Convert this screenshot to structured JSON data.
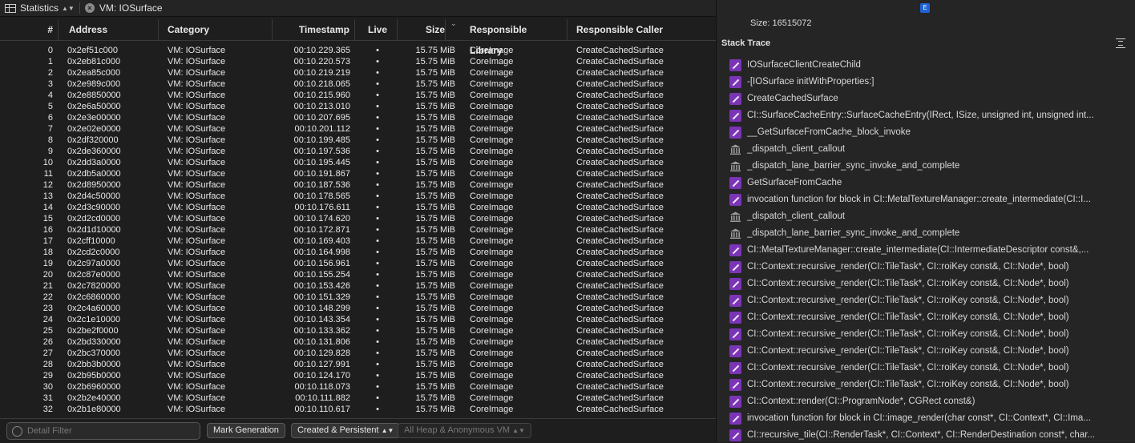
{
  "toolbar": {
    "view_label": "Statistics",
    "breadcrumb": "VM: IOSurface"
  },
  "columns": [
    "#",
    "Address",
    "Category",
    "Timestamp",
    "Live",
    "Size",
    "Responsible Library",
    "Responsible Caller"
  ],
  "rows": [
    [
      "0",
      "0x2ef51c000",
      "VM: IOSurface",
      "00:10.229.365",
      "•",
      "15.75 MiB",
      "CoreImage",
      "CreateCachedSurface"
    ],
    [
      "1",
      "0x2eb81c000",
      "VM: IOSurface",
      "00:10.220.573",
      "•",
      "15.75 MiB",
      "CoreImage",
      "CreateCachedSurface"
    ],
    [
      "2",
      "0x2ea85c000",
      "VM: IOSurface",
      "00:10.219.219",
      "•",
      "15.75 MiB",
      "CoreImage",
      "CreateCachedSurface"
    ],
    [
      "3",
      "0x2e989c000",
      "VM: IOSurface",
      "00:10.218.065",
      "•",
      "15.75 MiB",
      "CoreImage",
      "CreateCachedSurface"
    ],
    [
      "4",
      "0x2e8850000",
      "VM: IOSurface",
      "00:10.215.960",
      "•",
      "15.75 MiB",
      "CoreImage",
      "CreateCachedSurface"
    ],
    [
      "5",
      "0x2e6a50000",
      "VM: IOSurface",
      "00:10.213.010",
      "•",
      "15.75 MiB",
      "CoreImage",
      "CreateCachedSurface"
    ],
    [
      "6",
      "0x2e3e00000",
      "VM: IOSurface",
      "00:10.207.695",
      "•",
      "15.75 MiB",
      "CoreImage",
      "CreateCachedSurface"
    ],
    [
      "7",
      "0x2e02e0000",
      "VM: IOSurface",
      "00:10.201.112",
      "•",
      "15.75 MiB",
      "CoreImage",
      "CreateCachedSurface"
    ],
    [
      "8",
      "0x2df320000",
      "VM: IOSurface",
      "00:10.199.485",
      "•",
      "15.75 MiB",
      "CoreImage",
      "CreateCachedSurface"
    ],
    [
      "9",
      "0x2de360000",
      "VM: IOSurface",
      "00:10.197.536",
      "•",
      "15.75 MiB",
      "CoreImage",
      "CreateCachedSurface"
    ],
    [
      "10",
      "0x2dd3a0000",
      "VM: IOSurface",
      "00:10.195.445",
      "•",
      "15.75 MiB",
      "CoreImage",
      "CreateCachedSurface"
    ],
    [
      "11",
      "0x2db5a0000",
      "VM: IOSurface",
      "00:10.191.867",
      "•",
      "15.75 MiB",
      "CoreImage",
      "CreateCachedSurface"
    ],
    [
      "12",
      "0x2d8950000",
      "VM: IOSurface",
      "00:10.187.536",
      "•",
      "15.75 MiB",
      "CoreImage",
      "CreateCachedSurface"
    ],
    [
      "13",
      "0x2d4c50000",
      "VM: IOSurface",
      "00:10.178.565",
      "•",
      "15.75 MiB",
      "CoreImage",
      "CreateCachedSurface"
    ],
    [
      "14",
      "0x2d3c90000",
      "VM: IOSurface",
      "00:10.176.611",
      "•",
      "15.75 MiB",
      "CoreImage",
      "CreateCachedSurface"
    ],
    [
      "15",
      "0x2d2cd0000",
      "VM: IOSurface",
      "00:10.174.620",
      "•",
      "15.75 MiB",
      "CoreImage",
      "CreateCachedSurface"
    ],
    [
      "16",
      "0x2d1d10000",
      "VM: IOSurface",
      "00:10.172.871",
      "•",
      "15.75 MiB",
      "CoreImage",
      "CreateCachedSurface"
    ],
    [
      "17",
      "0x2cff10000",
      "VM: IOSurface",
      "00:10.169.403",
      "•",
      "15.75 MiB",
      "CoreImage",
      "CreateCachedSurface"
    ],
    [
      "18",
      "0x2cd2c0000",
      "VM: IOSurface",
      "00:10.164.998",
      "•",
      "15.75 MiB",
      "CoreImage",
      "CreateCachedSurface"
    ],
    [
      "19",
      "0x2c97a0000",
      "VM: IOSurface",
      "00:10.156.961",
      "•",
      "15.75 MiB",
      "CoreImage",
      "CreateCachedSurface"
    ],
    [
      "20",
      "0x2c87e0000",
      "VM: IOSurface",
      "00:10.155.254",
      "•",
      "15.75 MiB",
      "CoreImage",
      "CreateCachedSurface"
    ],
    [
      "21",
      "0x2c7820000",
      "VM: IOSurface",
      "00:10.153.426",
      "•",
      "15.75 MiB",
      "CoreImage",
      "CreateCachedSurface"
    ],
    [
      "22",
      "0x2c6860000",
      "VM: IOSurface",
      "00:10.151.329",
      "•",
      "15.75 MiB",
      "CoreImage",
      "CreateCachedSurface"
    ],
    [
      "23",
      "0x2c4a60000",
      "VM: IOSurface",
      "00:10.148.299",
      "•",
      "15.75 MiB",
      "CoreImage",
      "CreateCachedSurface"
    ],
    [
      "24",
      "0x2c1e10000",
      "VM: IOSurface",
      "00:10.143.354",
      "•",
      "15.75 MiB",
      "CoreImage",
      "CreateCachedSurface"
    ],
    [
      "25",
      "0x2be2f0000",
      "VM: IOSurface",
      "00:10.133.362",
      "•",
      "15.75 MiB",
      "CoreImage",
      "CreateCachedSurface"
    ],
    [
      "26",
      "0x2bd330000",
      "VM: IOSurface",
      "00:10.131.806",
      "•",
      "15.75 MiB",
      "CoreImage",
      "CreateCachedSurface"
    ],
    [
      "27",
      "0x2bc370000",
      "VM: IOSurface",
      "00:10.129.828",
      "•",
      "15.75 MiB",
      "CoreImage",
      "CreateCachedSurface"
    ],
    [
      "28",
      "0x2bb3b0000",
      "VM: IOSurface",
      "00:10.127.991",
      "•",
      "15.75 MiB",
      "CoreImage",
      "CreateCachedSurface"
    ],
    [
      "29",
      "0x2b95b0000",
      "VM: IOSurface",
      "00:10.124.170",
      "•",
      "15.75 MiB",
      "CoreImage",
      "CreateCachedSurface"
    ],
    [
      "30",
      "0x2b6960000",
      "VM: IOSurface",
      "00:10.118.073",
      "•",
      "15.75 MiB",
      "CoreImage",
      "CreateCachedSurface"
    ],
    [
      "31",
      "0x2b2e40000",
      "VM: IOSurface",
      "00:10.111.882",
      "•",
      "15.75 MiB",
      "CoreImage",
      "CreateCachedSurface"
    ],
    [
      "32",
      "0x2b1e80000",
      "VM: IOSurface",
      "00:10.110.617",
      "•",
      "15.75 MiB",
      "CoreImage",
      "CreateCachedSurface"
    ]
  ],
  "bottom": {
    "filter_placeholder": "Detail Filter",
    "mark_generation": "Mark Generation",
    "allocation_filter": "Created & Persistent",
    "heap_filter": "All Heap & Anonymous VM"
  },
  "detail": {
    "badge": "E",
    "size_label": "Size: 16515072",
    "stack_trace_title": "Stack Trace",
    "frames": [
      {
        "icon": "user",
        "text": "IOSurfaceClientCreateChild"
      },
      {
        "icon": "user",
        "text": "-[IOSurface initWithProperties:]"
      },
      {
        "icon": "user",
        "text": "CreateCachedSurface"
      },
      {
        "icon": "user",
        "text": "CI::SurfaceCacheEntry::SurfaceCacheEntry(IRect, ISize, unsigned int, unsigned int..."
      },
      {
        "icon": "user",
        "text": "__GetSurfaceFromCache_block_invoke"
      },
      {
        "icon": "sys",
        "text": "_dispatch_client_callout"
      },
      {
        "icon": "sys",
        "text": "_dispatch_lane_barrier_sync_invoke_and_complete"
      },
      {
        "icon": "user",
        "text": "GetSurfaceFromCache"
      },
      {
        "icon": "user",
        "text": "invocation function for block in CI::MetalTextureManager::create_intermediate(CI::I..."
      },
      {
        "icon": "sys",
        "text": "_dispatch_client_callout"
      },
      {
        "icon": "sys",
        "text": "_dispatch_lane_barrier_sync_invoke_and_complete"
      },
      {
        "icon": "user",
        "text": "CI::MetalTextureManager::create_intermediate(CI::IntermediateDescriptor const&,..."
      },
      {
        "icon": "user",
        "text": "CI::Context::recursive_render(CI::TileTask*, CI::roiKey const&, CI::Node*, bool)"
      },
      {
        "icon": "user",
        "text": "CI::Context::recursive_render(CI::TileTask*, CI::roiKey const&, CI::Node*, bool)"
      },
      {
        "icon": "user",
        "text": "CI::Context::recursive_render(CI::TileTask*, CI::roiKey const&, CI::Node*, bool)"
      },
      {
        "icon": "user",
        "text": "CI::Context::recursive_render(CI::TileTask*, CI::roiKey const&, CI::Node*, bool)"
      },
      {
        "icon": "user",
        "text": "CI::Context::recursive_render(CI::TileTask*, CI::roiKey const&, CI::Node*, bool)"
      },
      {
        "icon": "user",
        "text": "CI::Context::recursive_render(CI::TileTask*, CI::roiKey const&, CI::Node*, bool)"
      },
      {
        "icon": "user",
        "text": "CI::Context::recursive_render(CI::TileTask*, CI::roiKey const&, CI::Node*, bool)"
      },
      {
        "icon": "user",
        "text": "CI::Context::recursive_render(CI::TileTask*, CI::roiKey const&, CI::Node*, bool)"
      },
      {
        "icon": "user",
        "text": "CI::Context::render(CI::ProgramNode*, CGRect const&)"
      },
      {
        "icon": "user",
        "text": "invocation function for block in CI::image_render(char const*, CI::Context*, CI::Ima..."
      },
      {
        "icon": "user",
        "text": "CI::recursive_tile(CI::RenderTask*, CI::Context*, CI::RenderDestination const*, char..."
      }
    ]
  }
}
